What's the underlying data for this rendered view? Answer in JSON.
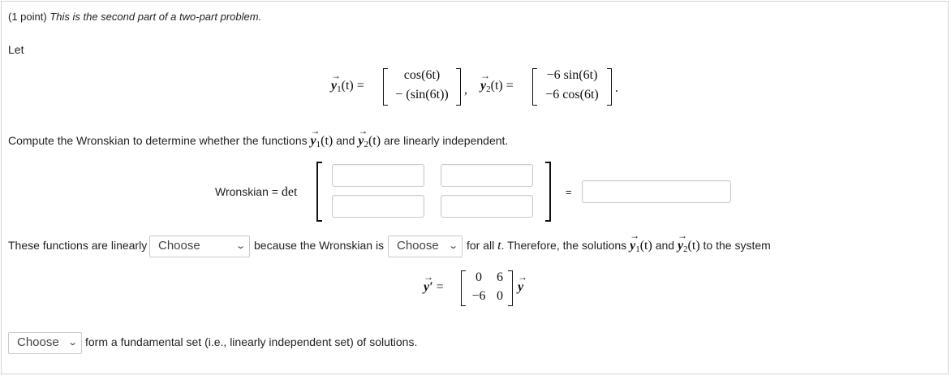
{
  "header": {
    "points": "(1 point)",
    "note": "This is the second part of a two-part problem."
  },
  "let_label": "Let",
  "vectors": {
    "y1_label": "y",
    "y1_sub": "1",
    "arg": "(t)",
    "eq": "=",
    "y1_top": "cos(6t)",
    "y1_bottom": "− (sin(6t))",
    "comma": ",",
    "y2_label": "y",
    "y2_sub": "2",
    "y2_top": "−6 sin(6t)",
    "y2_bottom": "−6 cos(6t)",
    "period": "."
  },
  "compute": {
    "pre": "Compute the Wronskian to determine whether the functions",
    "and": "and",
    "post": "are linearly independent."
  },
  "wronskian": {
    "label": "Wronskian =",
    "det": "det",
    "equals": "="
  },
  "sentence": {
    "pre": "These functions are linearly",
    "select1": "Choose",
    "mid": "because the Wronskian is",
    "select2": "Choose",
    "post1": "for all",
    "t": "t",
    "post2": ". Therefore, the solutions",
    "and": "and",
    "post3": "to the system"
  },
  "system": {
    "lhs": "y′",
    "eq": "=",
    "m11": "0",
    "m12": "6",
    "m21": "−6",
    "m22": "0",
    "rhs": "y"
  },
  "final": {
    "select3": "Choose",
    "text": "form a fundamental set (i.e., linearly independent set) of solutions."
  }
}
